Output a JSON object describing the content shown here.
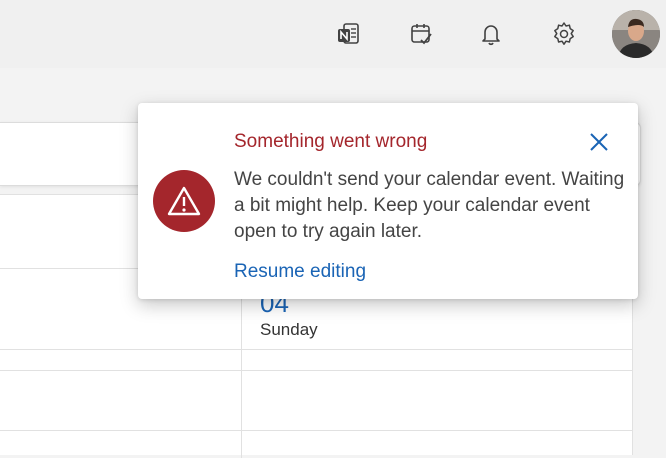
{
  "header": {
    "icons": [
      "onenote-icon",
      "todo-icon",
      "bell-icon",
      "gear-icon"
    ],
    "avatar": "user-avatar"
  },
  "calendar": {
    "day_number": "04",
    "day_name": "Sunday"
  },
  "dialog": {
    "title": "Something went wrong",
    "body": "We couldn't send your calendar event. Waiting a bit might help. Keep your calendar event open to try again later.",
    "link": "Resume editing",
    "icon": "warning-icon",
    "close_icon": "close-icon"
  },
  "colors": {
    "error": "#a4262c",
    "link": "#1a64b5",
    "topbar": "#f0f0f0"
  }
}
